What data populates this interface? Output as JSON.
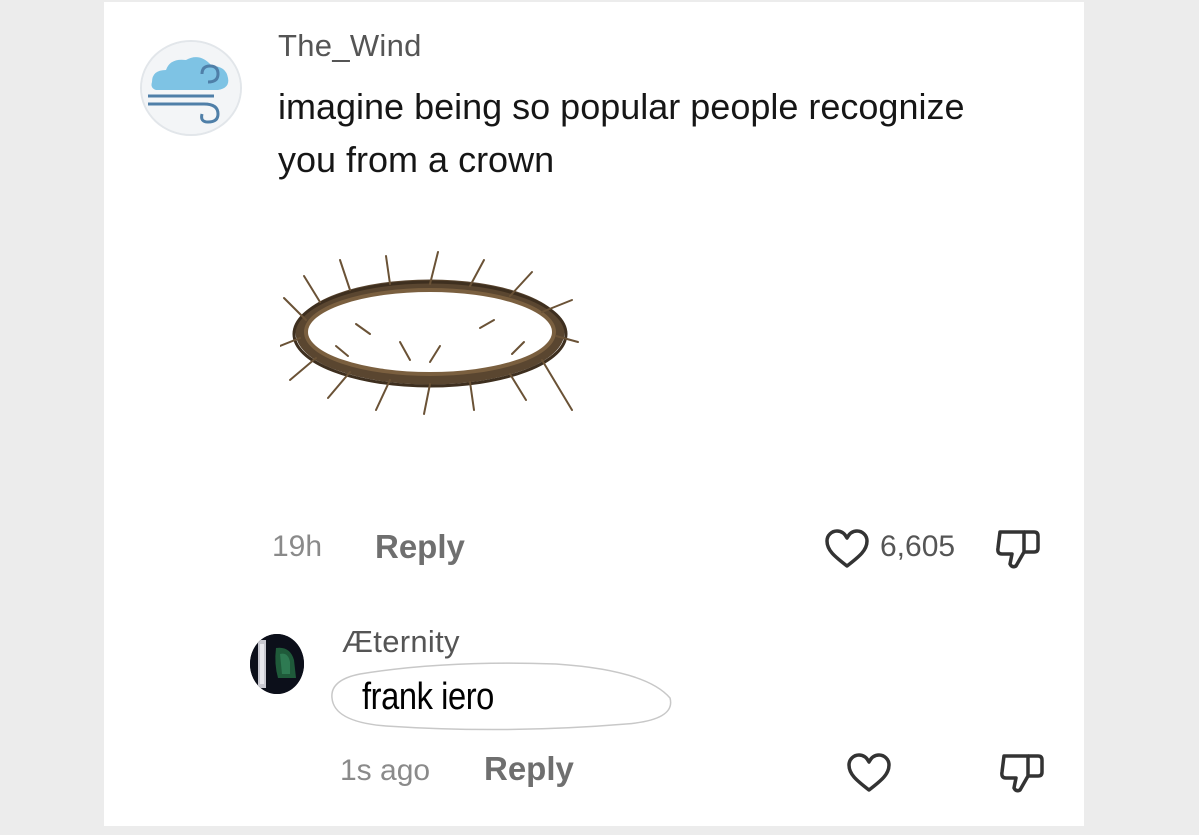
{
  "comments": [
    {
      "username": "The_Wind",
      "text": "imagine being so popular people recognize you from a crown",
      "time": "19h",
      "reply_label": "Reply",
      "likes": "6,605"
    },
    {
      "username": "Æternity",
      "text": "frank iero",
      "time": "1s ago",
      "reply_label": "Reply"
    }
  ]
}
